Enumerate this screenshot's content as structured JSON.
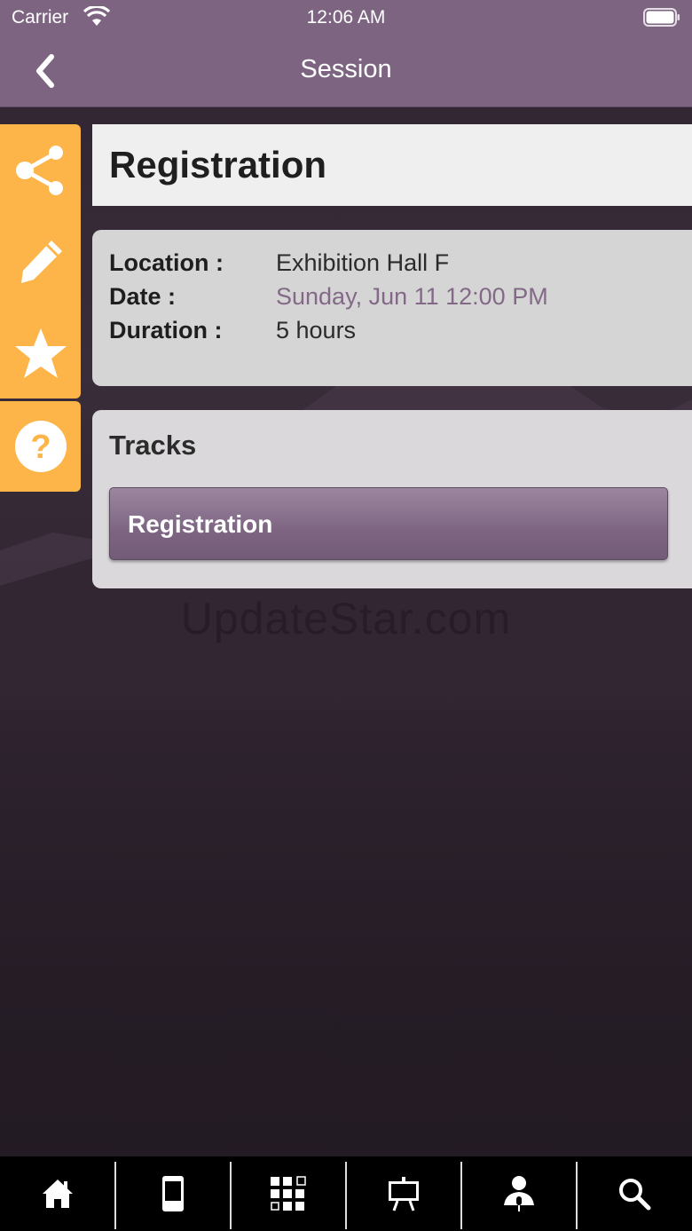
{
  "status_bar": {
    "carrier": "Carrier",
    "time": "12:06 AM"
  },
  "nav": {
    "title": "Session"
  },
  "session": {
    "title": "Registration",
    "location_label": "Location :",
    "location_value": "Exhibition Hall F",
    "date_label": "Date :",
    "date_value": "Sunday, Jun 11 12:00 PM",
    "duration_label": "Duration :",
    "duration_value": "5 hours"
  },
  "tracks": {
    "heading": "Tracks",
    "items": [
      "Registration"
    ]
  },
  "watermark": "UpdateStar.com",
  "sidebar": {
    "icons": [
      "share-icon",
      "pencil-icon",
      "star-icon",
      "help-icon"
    ]
  },
  "tabbar": {
    "icons": [
      "home-icon",
      "phone-icon",
      "qr-grid-icon",
      "presentation-icon",
      "speaker-icon",
      "search-icon"
    ]
  },
  "colors": {
    "nav_purple": "#7d6582",
    "accent_orange": "#fdb54a",
    "date_purple": "#836987"
  }
}
